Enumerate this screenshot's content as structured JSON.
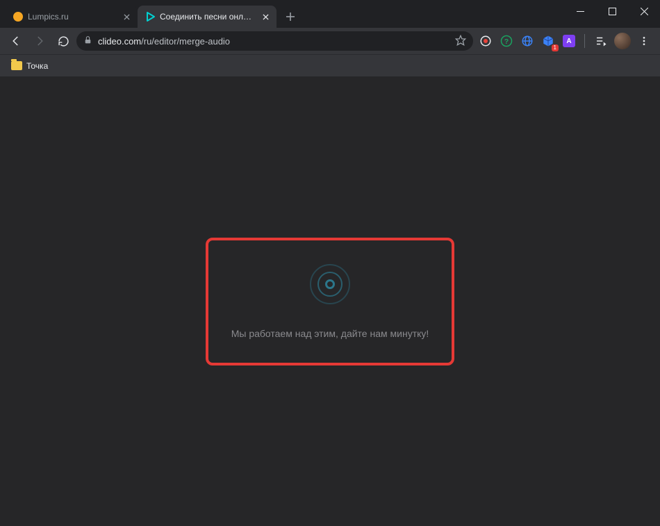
{
  "tabs": [
    {
      "title": "Lumpics.ru",
      "active": false
    },
    {
      "title": "Соединить песни онлайн — Со",
      "active": true
    }
  ],
  "address": {
    "lock_name": "lock-icon",
    "host": "clideo.com",
    "path": "/ru/editor/merge-audio",
    "star_name": "bookmark-star-icon"
  },
  "bookmarks": [
    {
      "label": "Точка",
      "kind": "folder"
    }
  ],
  "toolbar": {
    "back_name": "back-icon",
    "forward_name": "forward-icon",
    "reload_name": "reload-icon",
    "newtab_name": "plus-icon",
    "menu_name": "kebab-menu-icon",
    "readinglist_name": "reading-list-icon"
  },
  "extensions": [
    {
      "name": "yandex-ext-icon",
      "color": "#ffffff",
      "shape": "ring",
      "bg": "transparent"
    },
    {
      "name": "help-ext-icon",
      "color": "#1aa260",
      "shape": "help",
      "bg": "transparent"
    },
    {
      "name": "globe-ext-icon",
      "color": "#3b82f6",
      "shape": "globe",
      "bg": "transparent"
    },
    {
      "name": "cube-ext-icon",
      "color": "#3b82f6",
      "shape": "cube",
      "bg": "transparent"
    },
    {
      "name": "blocker-ext-icon",
      "color": "#ffffff",
      "shape": "square",
      "bg": "#7e3ff2"
    }
  ],
  "window_controls": {
    "minimize_name": "window-minimize-icon",
    "maximize_name": "window-maximize-icon",
    "close_name": "window-close-icon"
  },
  "content": {
    "loading_message": "Мы работаем над этим, дайте нам минутку!",
    "spinner_name": "loading-spinner-icon"
  },
  "colors": {
    "highlight_border": "#e53935",
    "spinner_ring": "#2c768a",
    "page_bg": "#262628"
  }
}
